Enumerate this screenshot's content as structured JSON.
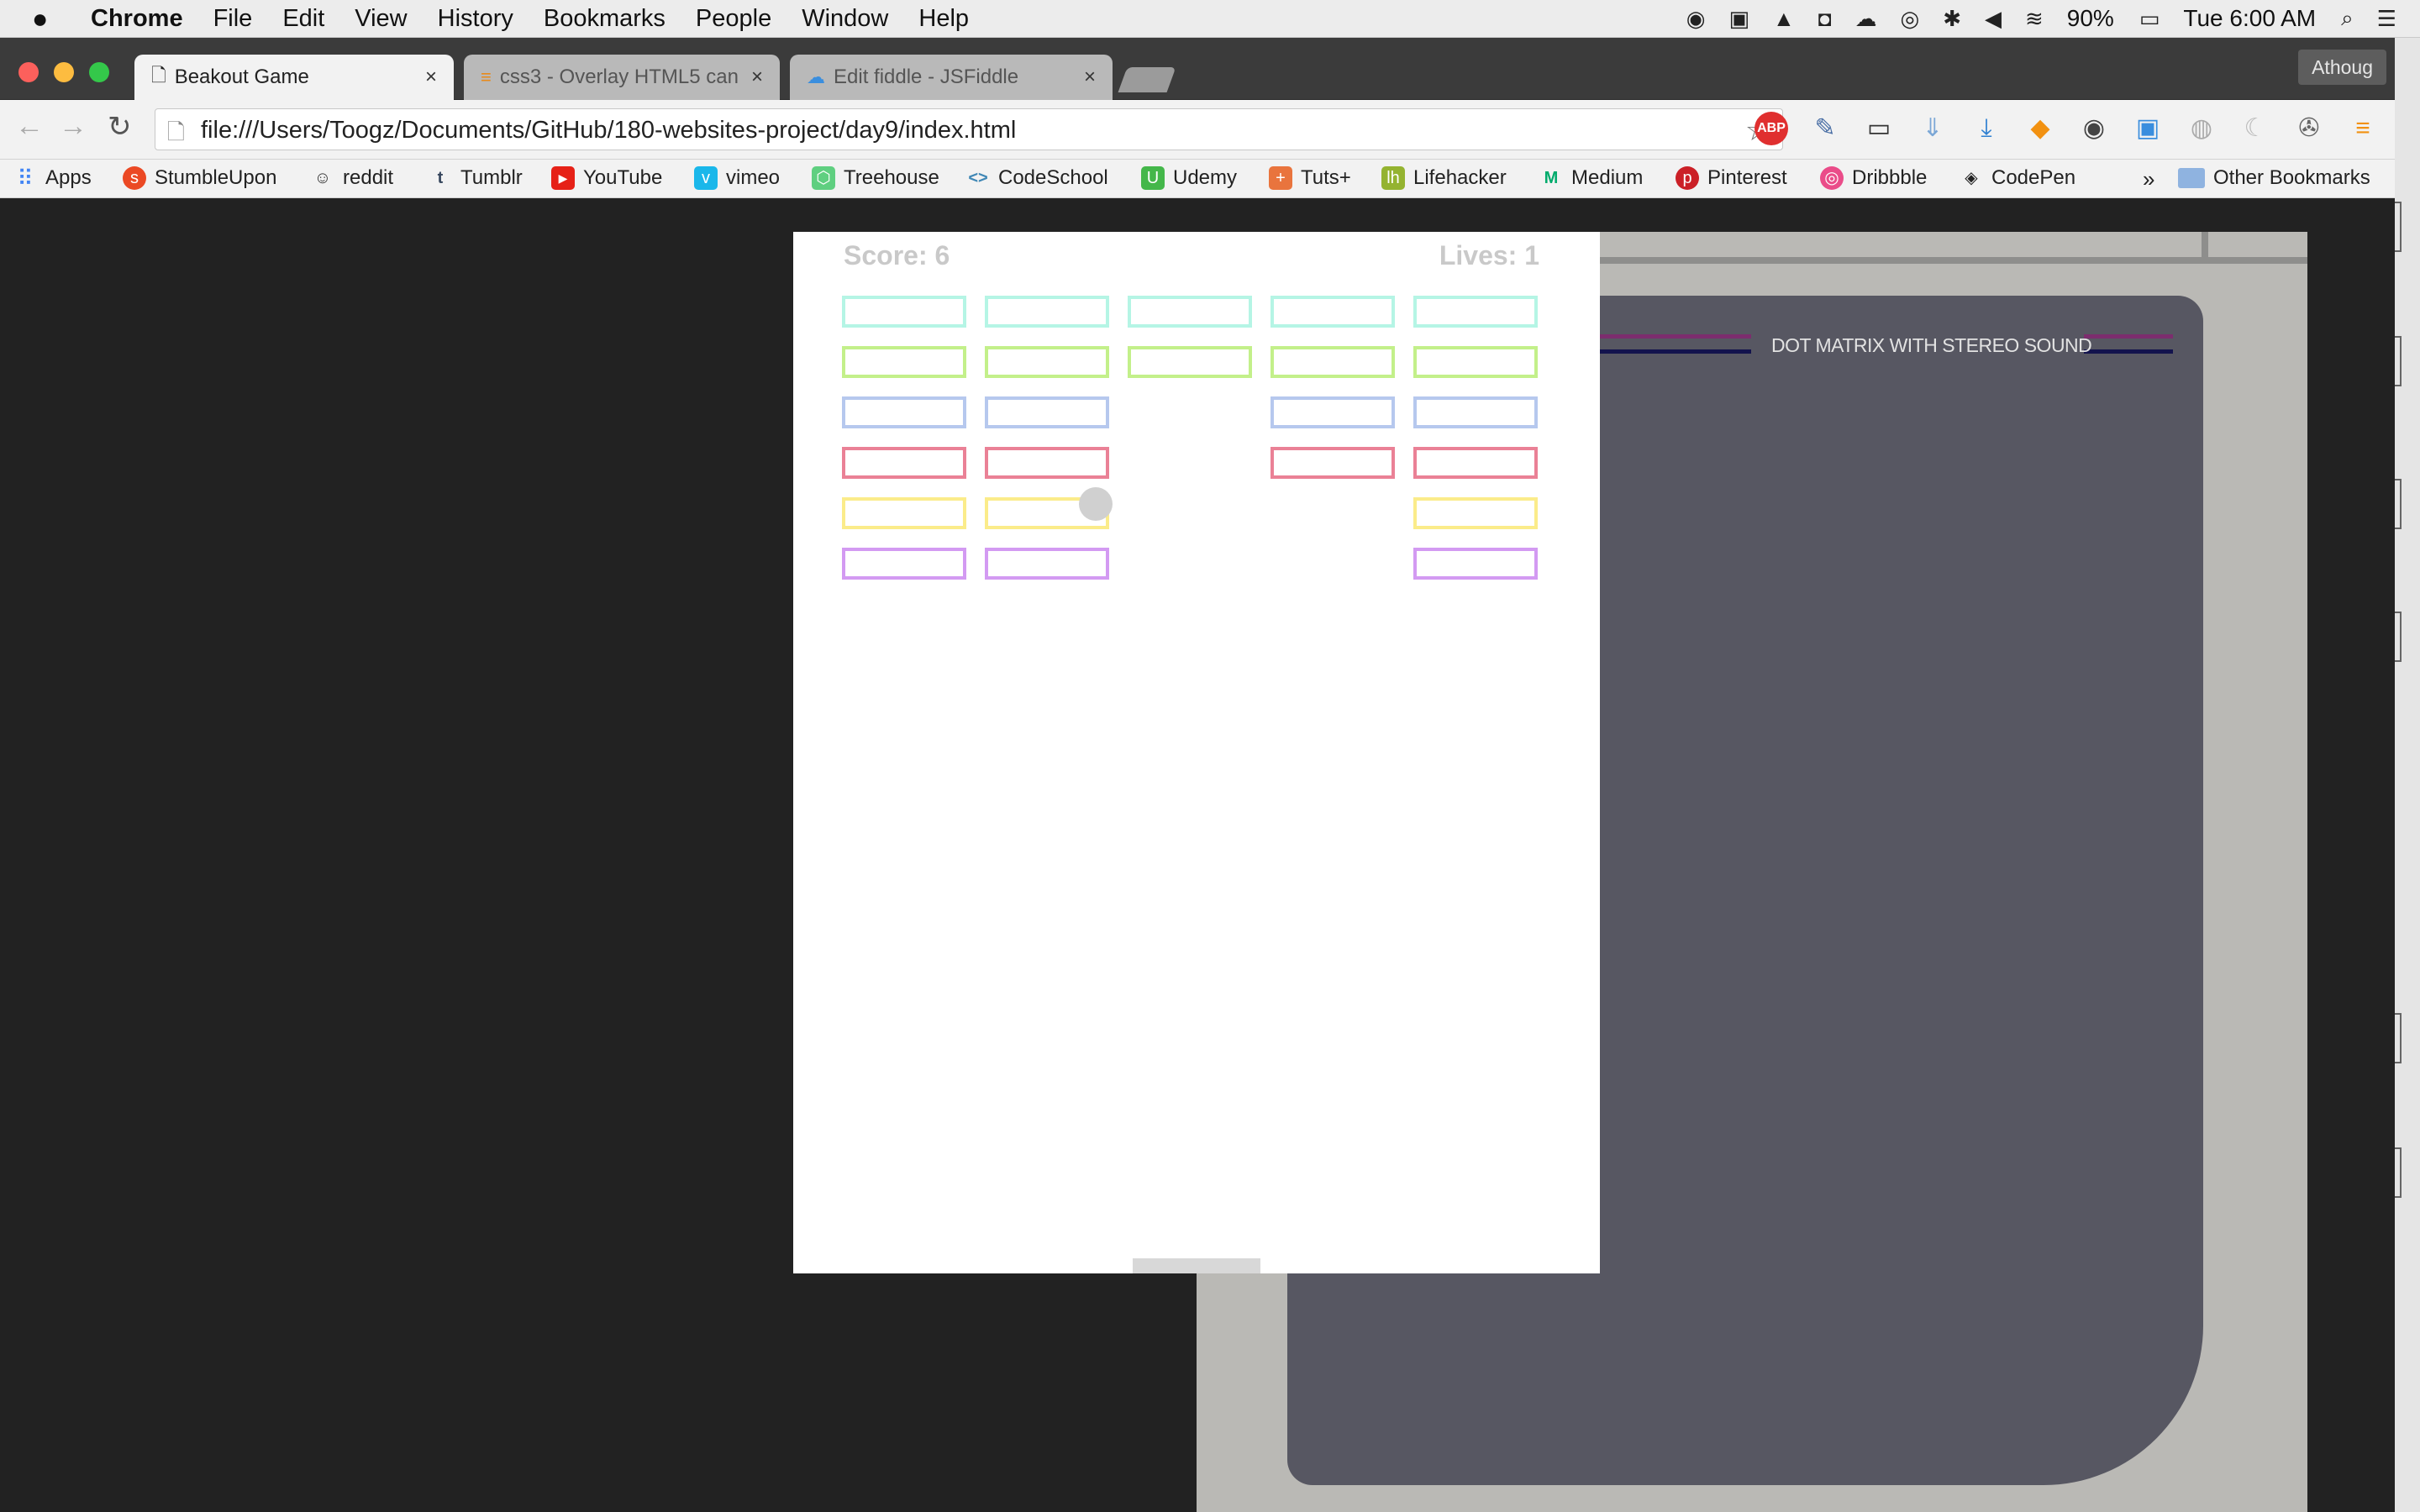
{
  "menubar": {
    "apple_icon": "apple-icon",
    "items": [
      "Chrome",
      "File",
      "Edit",
      "View",
      "History",
      "Bookmarks",
      "People",
      "Window",
      "Help"
    ],
    "battery": "90%",
    "clock": "Tue 6:00 AM"
  },
  "tabs": [
    {
      "title": "Beakout Game",
      "active": true,
      "icon": "page-icon"
    },
    {
      "title": "css3 - Overlay HTML5 can",
      "active": false,
      "icon": "stackoverflow-icon"
    },
    {
      "title": "Edit fiddle - JSFiddle",
      "active": false,
      "icon": "jsfiddle-icon"
    }
  ],
  "profile": {
    "name": "Athoug"
  },
  "address_bar": {
    "url": "file:///Users/Toogz/Documents/GitHub/180-websites-project/day9/index.html"
  },
  "bookmarks": {
    "items": [
      {
        "label": "Apps",
        "icon": "apps-grid-icon",
        "color": "#e0584f"
      },
      {
        "label": "StumbleUpon",
        "icon": "stumbleupon-icon",
        "color": "#eb4924"
      },
      {
        "label": "reddit",
        "icon": "reddit-icon",
        "color": "#ff4500"
      },
      {
        "label": "Tumblr",
        "icon": "tumblr-icon",
        "color": "#36465d"
      },
      {
        "label": "YouTube",
        "icon": "youtube-icon",
        "color": "#e62117"
      },
      {
        "label": "vimeo",
        "icon": "vimeo-icon",
        "color": "#1ab7ea"
      },
      {
        "label": "Treehouse",
        "icon": "treehouse-icon",
        "color": "#5fcf80"
      },
      {
        "label": "CodeSchool",
        "icon": "codeschool-icon",
        "color": "#3f87b5"
      },
      {
        "label": "Udemy",
        "icon": "udemy-icon",
        "color": "#44b74a"
      },
      {
        "label": "Tuts+",
        "icon": "tutsplus-icon",
        "color": "#e9743d"
      },
      {
        "label": "Lifehacker",
        "icon": "lifehacker-icon",
        "color": "#94b330"
      },
      {
        "label": "Medium",
        "icon": "medium-icon",
        "color": "#00ab6c"
      },
      {
        "label": "Pinterest",
        "icon": "pinterest-icon",
        "color": "#cb2027"
      },
      {
        "label": "Dribbble",
        "icon": "dribbble-icon",
        "color": "#ea4c89"
      },
      {
        "label": "CodePen",
        "icon": "codepen-icon",
        "color": "#222222"
      }
    ],
    "overflow": "»",
    "other": "Other Bookmarks"
  },
  "background_page": {
    "bezel_label": "DOT MATRIX WITH STEREO SOUND"
  },
  "game": {
    "score_label": "Score: 6",
    "lives_label": "Lives: 1",
    "brick_rows": [
      {
        "color": "#b5f5e5",
        "present": [
          true,
          true,
          true,
          true,
          true
        ]
      },
      {
        "color": "#c3f08a",
        "present": [
          true,
          true,
          true,
          true,
          true
        ]
      },
      {
        "color": "#b6c8ee",
        "present": [
          true,
          true,
          false,
          true,
          true
        ]
      },
      {
        "color": "#ea8196",
        "present": [
          true,
          true,
          false,
          true,
          true
        ]
      },
      {
        "color": "#fbec8a",
        "present": [
          true,
          true,
          false,
          false,
          true
        ]
      },
      {
        "color": "#d39af2",
        "present": [
          true,
          true,
          false,
          false,
          true
        ]
      }
    ]
  }
}
